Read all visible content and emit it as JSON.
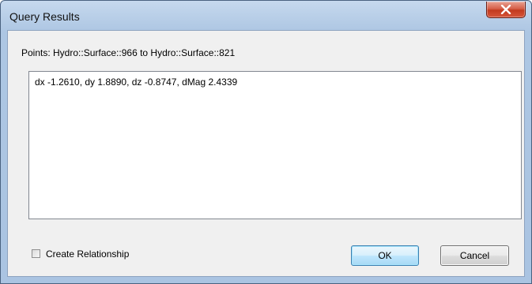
{
  "window": {
    "title": "Query Results",
    "close_icon": "close-x-icon"
  },
  "query": {
    "points_label": "Points: Hydro::Surface::966 to Hydro::Surface::821",
    "result_text": "dx -1.2610, dy 1.8890, dz -0.8747, dMag 2.4339"
  },
  "options": {
    "create_relationship_label": "Create Relationship",
    "create_relationship_checked": false
  },
  "buttons": {
    "ok_label": "OK",
    "cancel_label": "Cancel"
  },
  "colors": {
    "title_bar": "#b9cfe8",
    "close_button": "#c23a1e",
    "dialog_body": "#f0f0f0",
    "ok_button_highlight": "#bee6fd"
  }
}
